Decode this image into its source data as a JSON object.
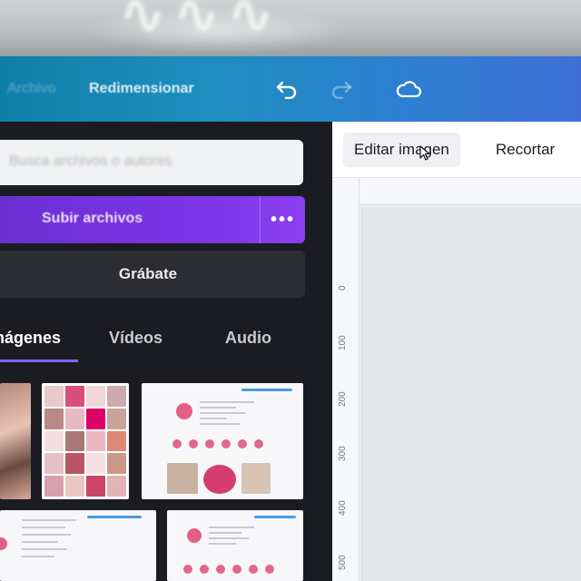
{
  "header": {
    "file_label": "Archivo",
    "resize_label": "Redimensionar",
    "undo_icon": "undo-icon",
    "redo_icon": "redo-icon",
    "cloud_icon": "cloud-icon"
  },
  "panel": {
    "search_placeholder": "Busca archivos o autores",
    "upload_label": "Subir archivos",
    "upload_more": "•••",
    "record_label": "Grábate",
    "tabs": [
      {
        "label": "Imágenes",
        "active": true
      },
      {
        "label": "Vídeos",
        "active": false
      },
      {
        "label": "Audio",
        "active": false
      }
    ]
  },
  "editor": {
    "edit_image_label": "Editar imagen",
    "crop_label": "Recortar",
    "ruler_ticks": [
      "0",
      "100",
      "200",
      "300",
      "400",
      "500"
    ]
  },
  "colors": {
    "accent_purple": "#7b33e6",
    "header_blue": "#1d8fbf",
    "tab_underline": "#7d64ff",
    "thumb_pink": "#e35f86"
  }
}
